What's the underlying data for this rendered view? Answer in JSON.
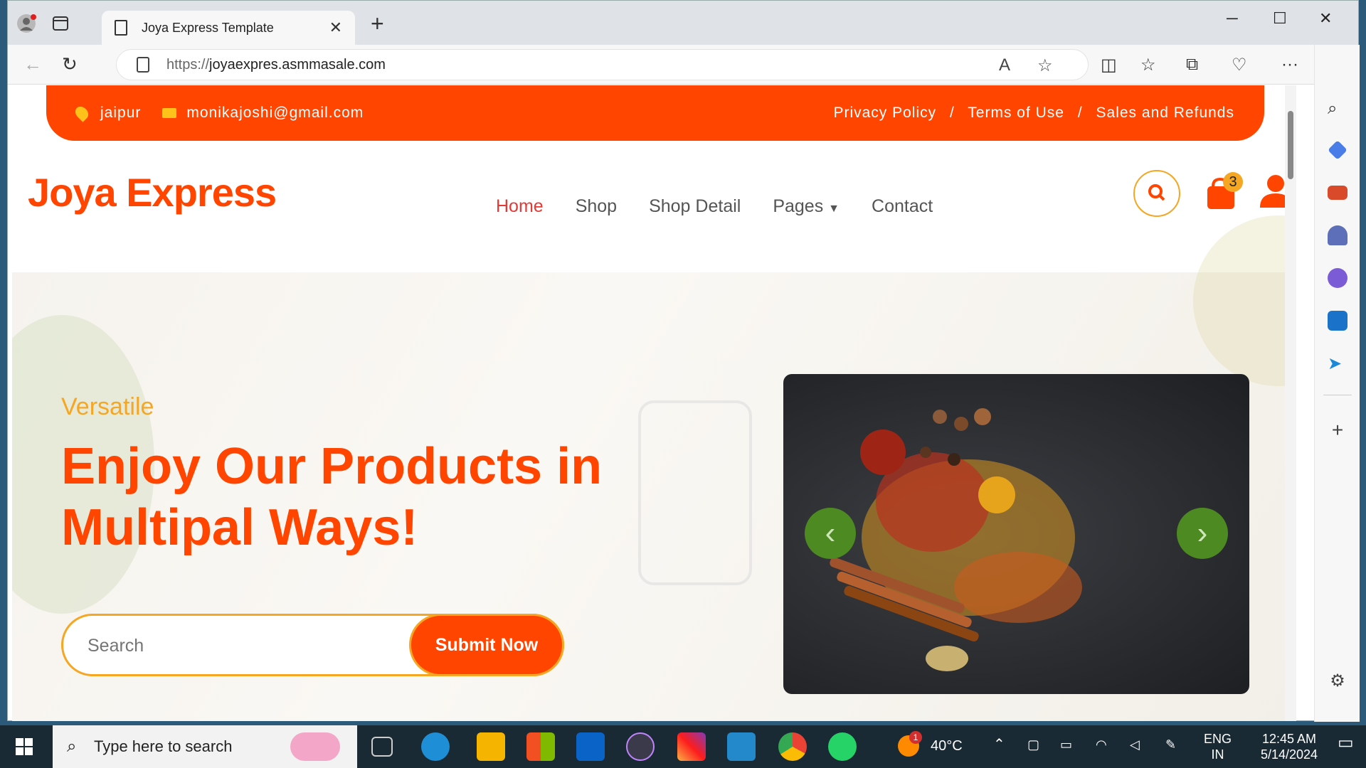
{
  "browser": {
    "tab_title": "Joya Express Template",
    "url_protocol": "https://",
    "url_host": "joyaexpres.asmmasale.com"
  },
  "topbar": {
    "location": "jaipur",
    "email": "monikajoshi@gmail.com",
    "links": [
      "Privacy Policy",
      "Terms of Use",
      "Sales and Refunds"
    ],
    "separator": "/"
  },
  "header": {
    "logo": "Joya Express",
    "menu": [
      "Home",
      "Shop",
      "Shop Detail",
      "Pages",
      "Contact"
    ],
    "cart_count": "3"
  },
  "hero": {
    "kicker": "Versatile",
    "headline": "Enjoy Our Products in Multipal Ways!",
    "search_placeholder": "Search",
    "submit_label": "Submit Now"
  },
  "taskbar": {
    "search_placeholder": "Type here to search",
    "weather": "40°C",
    "weather_badge": "1",
    "lang": "ENG",
    "region": "IN",
    "time": "12:45 AM",
    "date": "5/14/2024"
  },
  "colors": {
    "brand": "#ff4500",
    "accent": "#f5a623",
    "slider_arrow": "#4d8a22"
  }
}
